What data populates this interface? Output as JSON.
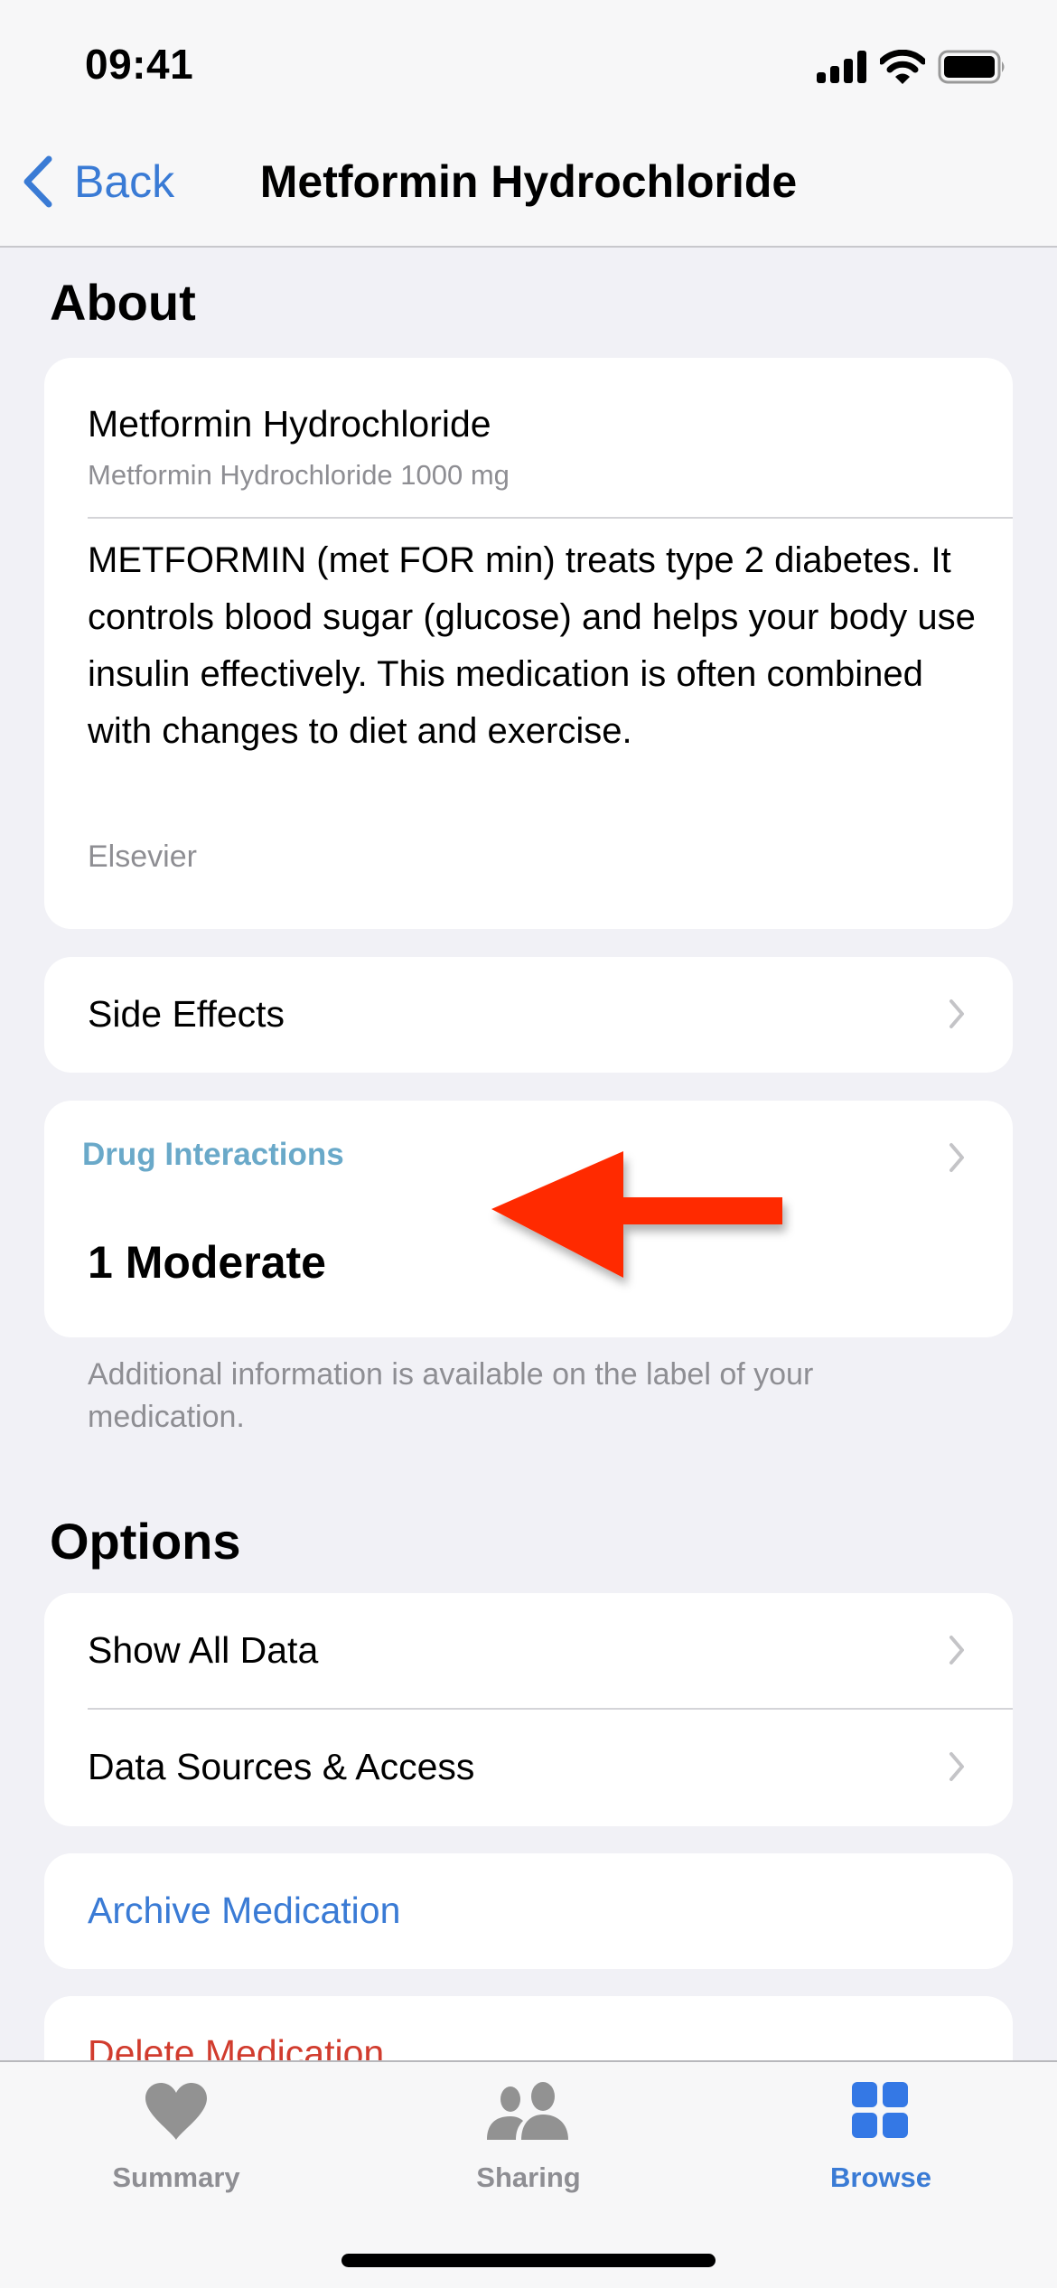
{
  "status_bar": {
    "time": "09:41",
    "icons": [
      "cellular-signal-icon",
      "wifi-icon",
      "battery-icon"
    ]
  },
  "nav": {
    "back_label": "Back",
    "title": "Metformin Hydrochloride"
  },
  "about": {
    "section_title": "About",
    "name": "Metformin Hydrochloride",
    "subtitle": "Metformin Hydrochloride 1000 mg",
    "description": "METFORMIN (met FOR min) treats type 2 diabetes. It controls blood sugar (glucose) and helps your body use insulin effectively. This medication is often combined with changes to diet and exercise.",
    "source": "Elsevier"
  },
  "side_effects": {
    "label": "Side Effects"
  },
  "drug_interactions": {
    "title": "Drug Interactions",
    "value": "1 Moderate",
    "footnote": "Additional information is available on the label of your medication."
  },
  "annotation": {
    "type": "arrow",
    "color": "#ff2a00",
    "points_to": "drug-interactions"
  },
  "options": {
    "section_title": "Options",
    "items": [
      {
        "label": "Show All Data"
      },
      {
        "label": "Data Sources & Access"
      }
    ],
    "archive_label": "Archive Medication",
    "delete_label": "Delete Medication"
  },
  "tabbar": {
    "active": "Browse",
    "tabs": [
      {
        "label": "Summary",
        "icon": "heart-icon"
      },
      {
        "label": "Sharing",
        "icon": "people-icon"
      },
      {
        "label": "Browse",
        "icon": "grid-icon"
      }
    ]
  },
  "colors": {
    "accent_blue": "#3a7bd5",
    "destructive_red": "#d13c2e",
    "section_link_teal": "#6aa9c9",
    "secondary_gray": "#8e8e93",
    "background": "#f1f1f6"
  }
}
